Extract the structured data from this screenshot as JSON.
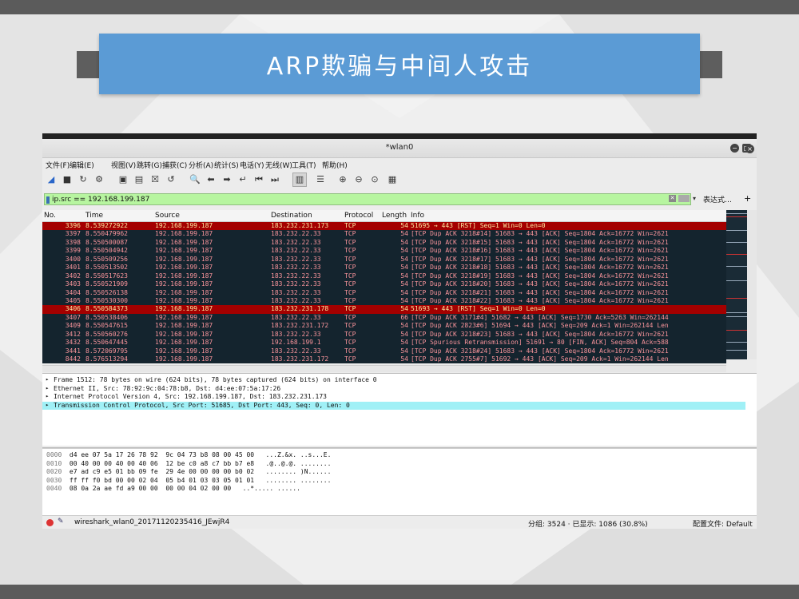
{
  "slide": {
    "title": "ARP欺骗与中间人攻击"
  },
  "window": {
    "title": "*wlan0",
    "controls": [
      "−",
      "□",
      "×"
    ]
  },
  "menu": [
    "文件(F)",
    "编辑(E)",
    "视图(V)",
    "跳转(G)",
    "捕获(C)",
    "分析(A)",
    "统计(S)",
    "电话(Y)",
    "无线(W)",
    "工具(T)",
    "帮助(H)"
  ],
  "toolbar": {
    "icons": [
      "shark-fin-start-icon",
      "stop-square-icon",
      "restart-icon",
      "options-gear-icon",
      "open-file-icon",
      "save-file-icon",
      "close-file-icon",
      "reload-icon",
      "find-packet-icon",
      "go-back-icon",
      "go-forward-icon",
      "go-to-packet-icon",
      "go-first-icon",
      "go-last-icon",
      "autoscroll-icon",
      "colorize-icon",
      "zoom-in-icon",
      "zoom-out-icon",
      "zoom-normal-icon",
      "resize-columns-icon"
    ],
    "glyphs": [
      "◢",
      "■",
      "↻",
      "⚙",
      "▣",
      "▤",
      "☒",
      "↺",
      "🔍",
      "⬅",
      "➡",
      "↵",
      "⏮",
      "⏭",
      "▥",
      "☰",
      "⊕",
      "⊖",
      "⊙",
      "▦"
    ]
  },
  "filter": {
    "value": "ip.src == 192.168.199.187",
    "clear_glyph": "✕",
    "dropdown_glyph": "▾",
    "expression_label": "表达式…",
    "plus_label": "+"
  },
  "packet_list": {
    "columns": [
      "No.",
      "Time",
      "Source",
      "Destination",
      "Protocol",
      "Length",
      "Info"
    ],
    "rows": [
      {
        "no": "3396",
        "time": "8.539272922",
        "src": "192.168.199.187",
        "dst": "183.232.231.173",
        "proto": "TCP",
        "len": "54",
        "info": "51695 → 443 [RST] Seq=1 Win=0 Len=0",
        "kind": "rst"
      },
      {
        "no": "3397",
        "time": "8.550479962",
        "src": "192.168.199.187",
        "dst": "183.232.22.33",
        "proto": "TCP",
        "len": "54",
        "info": "[TCP Dup ACK 3218#14] 51683 → 443 [ACK] Seq=1804 Ack=16772 Win=2621",
        "kind": "normal"
      },
      {
        "no": "3398",
        "time": "8.550500087",
        "src": "192.168.199.187",
        "dst": "183.232.22.33",
        "proto": "TCP",
        "len": "54",
        "info": "[TCP Dup ACK 3218#15] 51683 → 443 [ACK] Seq=1804 Ack=16772 Win=2621",
        "kind": "normal"
      },
      {
        "no": "3399",
        "time": "8.550504942",
        "src": "192.168.199.187",
        "dst": "183.232.22.33",
        "proto": "TCP",
        "len": "54",
        "info": "[TCP Dup ACK 3218#16] 51683 → 443 [ACK] Seq=1804 Ack=16772 Win=2621",
        "kind": "normal"
      },
      {
        "no": "3400",
        "time": "8.550509256",
        "src": "192.168.199.187",
        "dst": "183.232.22.33",
        "proto": "TCP",
        "len": "54",
        "info": "[TCP Dup ACK 3218#17] 51683 → 443 [ACK] Seq=1804 Ack=16772 Win=2621",
        "kind": "normal"
      },
      {
        "no": "3401",
        "time": "8.550513502",
        "src": "192.168.199.187",
        "dst": "183.232.22.33",
        "proto": "TCP",
        "len": "54",
        "info": "[TCP Dup ACK 3218#18] 51683 → 443 [ACK] Seq=1804 Ack=16772 Win=2621",
        "kind": "normal"
      },
      {
        "no": "3402",
        "time": "8.550517623",
        "src": "192.168.199.187",
        "dst": "183.232.22.33",
        "proto": "TCP",
        "len": "54",
        "info": "[TCP Dup ACK 3218#19] 51683 → 443 [ACK] Seq=1804 Ack=16772 Win=2621",
        "kind": "normal"
      },
      {
        "no": "3403",
        "time": "8.550521909",
        "src": "192.168.199.187",
        "dst": "183.232.22.33",
        "proto": "TCP",
        "len": "54",
        "info": "[TCP Dup ACK 3218#20] 51683 → 443 [ACK] Seq=1804 Ack=16772 Win=2621",
        "kind": "normal"
      },
      {
        "no": "3404",
        "time": "8.550526138",
        "src": "192.168.199.187",
        "dst": "183.232.22.33",
        "proto": "TCP",
        "len": "54",
        "info": "[TCP Dup ACK 3218#21] 51683 → 443 [ACK] Seq=1804 Ack=16772 Win=2621",
        "kind": "normal"
      },
      {
        "no": "3405",
        "time": "8.550530300",
        "src": "192.168.199.187",
        "dst": "183.232.22.33",
        "proto": "TCP",
        "len": "54",
        "info": "[TCP Dup ACK 3218#22] 51683 → 443 [ACK] Seq=1804 Ack=16772 Win=2621",
        "kind": "normal"
      },
      {
        "no": "3406",
        "time": "8.550584373",
        "src": "192.168.199.187",
        "dst": "183.232.231.178",
        "proto": "TCP",
        "len": "54",
        "info": "51693 → 443 [RST] Seq=1 Win=0 Len=0",
        "kind": "rst"
      },
      {
        "no": "3407",
        "time": "8.550538406",
        "src": "192.168.199.187",
        "dst": "183.232.22.33",
        "proto": "TCP",
        "len": "66",
        "info": "[TCP Dup ACK 3171#4] 51682 → 443 [ACK] Seq=1730 Ack=5263 Win=262144",
        "kind": "normal"
      },
      {
        "no": "3409",
        "time": "8.550547615",
        "src": "192.168.199.187",
        "dst": "183.232.231.172",
        "proto": "TCP",
        "len": "54",
        "info": "[TCP Dup ACK 2823#6] 51694 → 443 [ACK] Seq=209 Ack=1 Win=262144 Len",
        "kind": "normal"
      },
      {
        "no": "3412",
        "time": "8.550560276",
        "src": "192.168.199.187",
        "dst": "183.232.22.33",
        "proto": "TCP",
        "len": "54",
        "info": "[TCP Dup ACK 3218#23] 51683 → 443 [ACK] Seq=1804 Ack=16772 Win=2621",
        "kind": "normal"
      },
      {
        "no": "3432",
        "time": "8.550647445",
        "src": "192.168.199.187",
        "dst": "192.168.199.1",
        "proto": "TCP",
        "len": "54",
        "info": "[TCP Spurious Retransmission] 51691 → 80 [FIN, ACK] Seq=804 Ack=588",
        "kind": "normal"
      },
      {
        "no": "3441",
        "time": "8.572069795",
        "src": "192.168.199.187",
        "dst": "183.232.22.33",
        "proto": "TCP",
        "len": "54",
        "info": "[TCP Dup ACK 3218#24] 51683 → 443 [ACK] Seq=1804 Ack=16772 Win=2621",
        "kind": "normal"
      },
      {
        "no": "8442",
        "time": "8.576513294",
        "src": "192.168.199.187",
        "dst": "183.232.231.172",
        "proto": "TCP",
        "len": "54",
        "info": "[TCP Dup ACK 2755#7] 51692 → 443 [ACK] Seq=209 Ack=1 Win=262144 Len",
        "kind": "normal"
      }
    ]
  },
  "details": [
    {
      "text": "Frame 1512: 78 bytes on wire (624 bits), 78 bytes captured (624 bits) on interface 0",
      "selected": false
    },
    {
      "text": "Ethernet II, Src: 78:92:9c:04:78:b8, Dst: d4:ee:07:5a:17:26",
      "selected": false
    },
    {
      "text": "Internet Protocol Version 4, Src: 192.168.199.187, Dst: 183.232.231.173",
      "selected": false
    },
    {
      "text": "Transmission Control Protocol, Src Port: 51685, Dst Port: 443, Seq: 0, Len: 0",
      "selected": true
    }
  ],
  "bytes": [
    {
      "off": "0000",
      "hex": "d4 ee 07 5a 17 26 78 92  9c 04 73 b8 08 00 45 00",
      "ascii": "...Z.&x. ..s...E."
    },
    {
      "off": "0010",
      "hex": "00 40 00 00 40 00 40 06  12 be c0 a8 c7 bb b7 e8",
      "ascii": ".@..@.@. ........"
    },
    {
      "off": "0020",
      "hex": "e7 ad c9 e5 01 bb 09 fe  29 4e 00 00 00 00 b0 02",
      "ascii": "........ )N......"
    },
    {
      "off": "0030",
      "hex": "ff ff f0 bd 00 00 02 04  05 b4 01 03 03 05 01 01",
      "ascii": "........ ........"
    },
    {
      "off": "0040",
      "hex": "08 0a 2a ae fd a9 00 00  00 00 04 02 00 00",
      "ascii": "..*..... ......"
    }
  ],
  "status": {
    "file": "wireshark_wlan0_20171120235416_JEwjR4",
    "packets": "分组: 3524 · 已显示: 1086 (30.8%)",
    "profile": "配置文件: Default"
  },
  "colors": {
    "banner": "#5b9bd5",
    "row_bg": "#14242e",
    "row_fg": "#f9949b",
    "rst_bg": "#a40000",
    "rst_fg": "#ffe9a0",
    "filter_ok": "#b7f5a0",
    "selected_detail": "#a0f0f6"
  }
}
